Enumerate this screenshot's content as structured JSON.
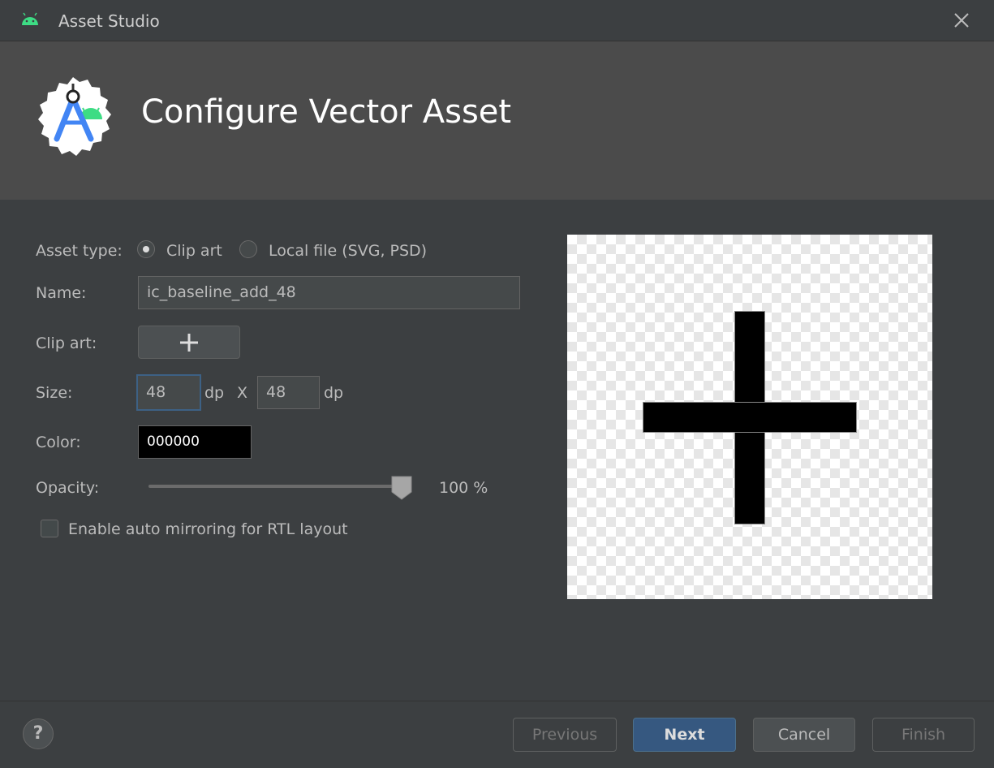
{
  "window": {
    "title": "Asset Studio"
  },
  "header": {
    "heading": "Configure Vector Asset"
  },
  "form": {
    "asset_type_label": "Asset type:",
    "asset_type_options": [
      {
        "label": "Clip art",
        "checked": true
      },
      {
        "label": "Local file (SVG, PSD)",
        "checked": false
      }
    ],
    "name_label": "Name:",
    "name_value": "ic_baseline_add_48",
    "clip_art_label": "Clip art:",
    "size_label": "Size:",
    "width_value": "48",
    "width_unit": "dp",
    "size_separator": "X",
    "height_value": "48",
    "height_unit": "dp",
    "color_label": "Color:",
    "color_value": "000000",
    "opacity_label": "Opacity:",
    "opacity_value": 100,
    "opacity_text": "100 %",
    "rtl_label": "Enable auto mirroring for RTL layout",
    "rtl_checked": false
  },
  "footer": {
    "help_label": "?",
    "previous_label": "Previous",
    "next_label": "Next",
    "cancel_label": "Cancel",
    "finish_label": "Finish"
  },
  "icons": {
    "window": "android-icon",
    "logo": "android-studio-logo",
    "close": "close-icon",
    "clip_art": "add-icon",
    "help": "help-icon"
  },
  "colors": {
    "accent": "#365880",
    "focus_border": "#3d6185",
    "selected_color": "#000000",
    "android_green": "#3ddc84",
    "studio_blue": "#4285f4"
  }
}
